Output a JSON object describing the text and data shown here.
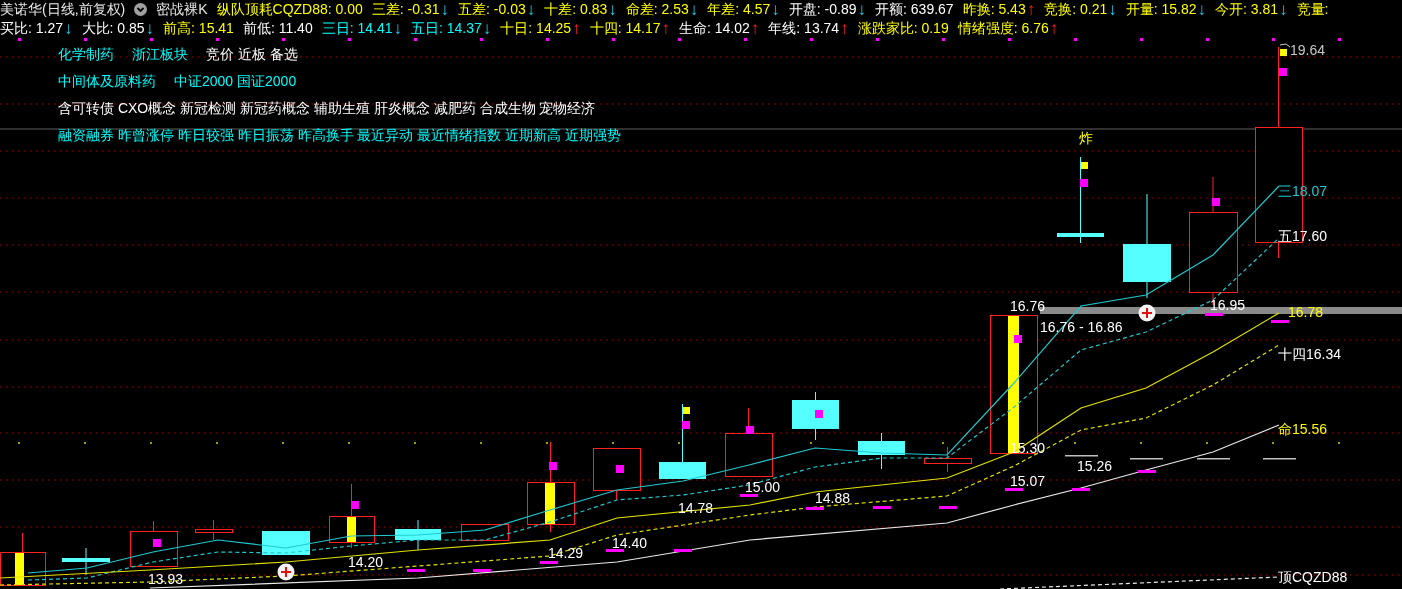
{
  "title": {
    "stock": "美诺华(日线,前复权)",
    "indicator": "密战裸K"
  },
  "header_rows": [
    [
      {
        "text": "纵队顶耗CQZD88: 0.00",
        "color": "#ffff00"
      },
      {
        "text": "三差: -0.31",
        "color": "#ffff00",
        "arrow": "↓",
        "up": false
      },
      {
        "text": "五差: -0.03",
        "color": "#ffff00",
        "arrow": "↓",
        "up": false
      },
      {
        "text": "十差: 0.83",
        "color": "#ffff00",
        "arrow": "↓",
        "up": false
      },
      {
        "text": "命差: 2.53",
        "color": "#ffff00",
        "arrow": "↓",
        "up": false
      },
      {
        "text": "年差: 4.57",
        "color": "#ffff00",
        "arrow": "↓",
        "up": false
      },
      {
        "text": "开盘: -0.89",
        "color": "#ffffff",
        "arrow": "↓",
        "up": false
      },
      {
        "text": "开额: 639.67",
        "color": "#ffffff"
      },
      {
        "text": "昨换: 5.43",
        "color": "#ffff00",
        "arrow": "↑",
        "up": true
      },
      {
        "text": "竞换: 0.21",
        "color": "#ffff00",
        "arrow": "↓",
        "up": false
      },
      {
        "text": "开量: 15.82",
        "color": "#ffff00",
        "arrow": "↓",
        "up": false
      },
      {
        "text": "今开: 3.81",
        "color": "#ffff00",
        "arrow": "↓",
        "up": false
      },
      {
        "text": "竞量:",
        "color": "#ffff00"
      }
    ],
    [
      {
        "text": "买比: 1.27",
        "color": "#ffffff",
        "arrow": "↓",
        "up": false
      },
      {
        "text": "大比: 0.85",
        "color": "#ffffff",
        "arrow": "↓",
        "up": false
      },
      {
        "text": "前高: 15.41",
        "color": "#ffff00"
      },
      {
        "text": "前低: 11.40",
        "color": "#ffffff"
      },
      {
        "text": "三日: 14.41",
        "color": "#00ffff",
        "arrow": "↓",
        "up": false
      },
      {
        "text": "五日: 14.37",
        "color": "#00ffff",
        "arrow": "↓",
        "up": false
      },
      {
        "text": "十日: 14.25",
        "color": "#ffff00",
        "arrow": "↑",
        "up": true
      },
      {
        "text": "十四: 14.17",
        "color": "#ffff00",
        "arrow": "↑",
        "up": true
      },
      {
        "text": "生命: 14.02",
        "color": "#ffffff",
        "arrow": "↑",
        "up": true
      },
      {
        "text": "年线: 13.74",
        "color": "#ffffff",
        "arrow": "↑",
        "up": true
      },
      {
        "text": "涨跌家比: 0.19",
        "color": "#ffff00"
      },
      {
        "text": "情绪强度: 6.76",
        "color": "#ffff00",
        "arrow": "↑",
        "up": true
      }
    ]
  ],
  "sectors": [
    [
      {
        "text": "化学制药",
        "color": "#00ffff"
      },
      {
        "text": "浙江板块",
        "color": "#00ffff"
      },
      {
        "text": "竞价 近板 备选",
        "color": "#ffffff"
      }
    ],
    [
      {
        "text": "中间体及原料药",
        "color": "#00ffff"
      },
      {
        "text": "中证2000 国证2000",
        "color": "#00ffff"
      }
    ],
    [
      {
        "text": "含可转债 CXO概念 新冠检测 新冠药概念 辅助生殖 肝炎概念 减肥药 合成生物 宠物经济",
        "color": "#ffffff"
      }
    ],
    [
      {
        "text": "融资融券 昨曾涨停 昨日较强 昨日振荡 昨高换手 最近异动 最近情绪指数 近期新高 近期强势",
        "color": "#00ffff"
      }
    ]
  ],
  "chart_labels": [
    {
      "text": "炸",
      "color": "#ffff00"
    },
    {
      "text": "19.64",
      "color": "#c8c8c8"
    },
    {
      "text": "三18.07",
      "color": "#20c8d0"
    },
    {
      "text": "五17.60",
      "color": "#ffffff"
    },
    {
      "text": "16.76",
      "color": "#ffffff"
    },
    {
      "text": "16.95",
      "color": "#ffffff"
    },
    {
      "text": "16.78",
      "color": "#ffff00"
    },
    {
      "text": "16.76 - 16.86",
      "color": "#ffffff"
    },
    {
      "text": "十四16.34",
      "color": "#ffffff"
    },
    {
      "text": "命15.56",
      "color": "#ffff00"
    },
    {
      "text": "15.30",
      "color": "#ffffff"
    },
    {
      "text": "15.26",
      "color": "#ffffff"
    },
    {
      "text": "15.07",
      "color": "#ffffff"
    },
    {
      "text": "15.00",
      "color": "#ffffff"
    },
    {
      "text": "14.88",
      "color": "#ffffff"
    },
    {
      "text": "14.78",
      "color": "#ffffff"
    },
    {
      "text": "14.40",
      "color": "#ffffff"
    },
    {
      "text": "14.29",
      "color": "#ffffff"
    },
    {
      "text": "14.20",
      "color": "#ffffff"
    },
    {
      "text": "13.93",
      "color": "#ffffff"
    },
    {
      "text": "顶CQZD88",
      "color": "#ffffff"
    }
  ]
}
